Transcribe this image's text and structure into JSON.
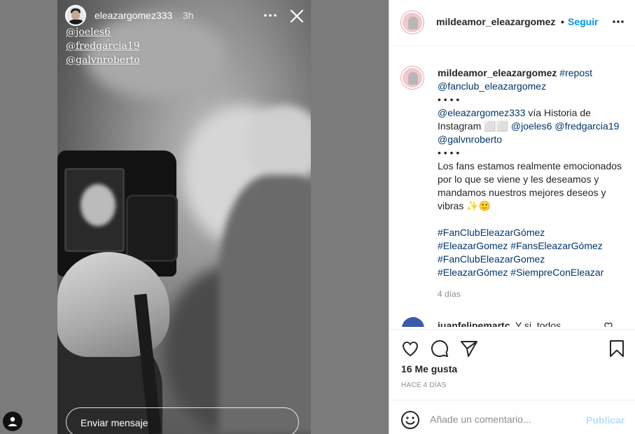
{
  "story": {
    "username": "eleazargomez333",
    "time": "3h",
    "mentions": [
      "@joeles6",
      "@fredgarcia19",
      "@galvnroberto"
    ],
    "send_message_placeholder": "Enviar mensaje",
    "more_icon": "more-horizontal-icon",
    "close_icon": "close-icon"
  },
  "post": {
    "header": {
      "username": "mildeamor_eleazargomez",
      "separator": "•",
      "follow_label": "Seguir",
      "more_icon": "more-horizontal-icon"
    },
    "caption": {
      "username": "mildeamor_eleazargomez",
      "tag_repost": "#repost",
      "mention_fanclub": "@fanclub_eleazargomez",
      "dots1": "• • • •",
      "mention_source": "@eleazargomez333",
      "via_text": " vía Historia de Instagram ⬜⬜ ",
      "mention_1": "@joeles6",
      "mention_2": "@fredgarcia19",
      "mention_3": "@galvnroberto",
      "dots2": "• • • •",
      "body_text": "Los fans estamos realmente emocionados por lo que se viene y les deseamos y mandamos nuestros mejores deseos y vibras ✨🙂",
      "hashtags_line1": "#FanClubEleazarGómez",
      "hashtags_line2a": "#EleazarGomez",
      "hashtags_line2b": "#FansEleazarGómez",
      "hashtags_line3": "#FanClubEleazarGomez",
      "hashtags_line4a": "#EleazarGómez",
      "hashtags_line4b": "#SiempreConEleazar",
      "age": "4 días"
    },
    "comment": {
      "username": "juanfelipemartc",
      "text": "Y si, todos"
    },
    "likes": "16 Me gusta",
    "post_age": "HACE 4 DÍAS",
    "comment_placeholder": "Añade un comentario...",
    "publish_label": "Publicar"
  },
  "colors": {
    "accent": "#0095f6",
    "link": "#00376b",
    "muted": "#8e8e8e",
    "publish_disabled": "#b2dffc"
  }
}
